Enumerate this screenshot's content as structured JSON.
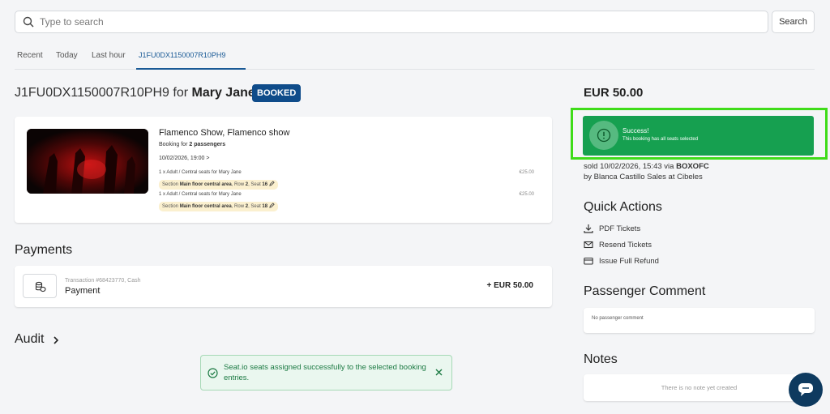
{
  "search": {
    "placeholder": "Type to search",
    "value": "",
    "button_label": "Search"
  },
  "tabs": [
    {
      "label": "Recent"
    },
    {
      "label": "Today"
    },
    {
      "label": "Last hour"
    },
    {
      "label": "J1FU0DX1150007R10PH9",
      "active": true
    }
  ],
  "booking": {
    "code": "J1FU0DX1150007R10PH9",
    "for_word": " for ",
    "customer": "Mary Jane",
    "status": "BOOKED"
  },
  "show": {
    "name": "Flamenco Show, Flamenco show",
    "booking_for_prefix": "Booking for ",
    "booking_for_count": "2 passengers",
    "date": "10/02/2026, 19:00 >",
    "lines": [
      {
        "desc": "1 x Adult / Central seats for ",
        "name": "Mary Jane",
        "price": "€25.00",
        "section_prefix": "Section ",
        "section": "Main floor central area",
        "row_prefix": ", Row ",
        "row": "2",
        "seat_prefix": ", Seat ",
        "seat": "16"
      },
      {
        "desc": "1 x Adult / Central seats for ",
        "name": "Mary Jane",
        "price": "€25.00",
        "section_prefix": "Section ",
        "section": "Main floor central area",
        "row_prefix": ", Row ",
        "row": "2",
        "seat_prefix": ", Seat ",
        "seat": "18"
      }
    ]
  },
  "payments": {
    "heading": "Payments",
    "transaction": "Transaction #68423770, Cash",
    "label": "Payment",
    "amount": "+ EUR 50.00"
  },
  "audit": {
    "heading": "Audit"
  },
  "toast": {
    "message": "Seat.io seats assigned successfully to the selected booking entries."
  },
  "summary": {
    "total": "EUR 50.00",
    "success_title": "Success!",
    "success_sub": "This booking has all seats selected",
    "sold_prefix": "sold 10/02/2026, 15:43 via ",
    "sold_channel": "BOXOFC",
    "sold_by": "by Blanca Castillo Sales at Cibeles"
  },
  "quick_actions": {
    "heading": "Quick Actions",
    "items": [
      {
        "label": "PDF Tickets",
        "icon": "download-icon"
      },
      {
        "label": "Resend Tickets",
        "icon": "mail-icon"
      },
      {
        "label": "Issue Full Refund",
        "icon": "credit-card-icon"
      }
    ]
  },
  "passenger_comment": {
    "heading": "Passenger Comment",
    "text": "No passenger comment"
  },
  "notes": {
    "heading": "Notes",
    "text": "There is no note yet created"
  },
  "colors": {
    "primary": "#0f4c8a",
    "success": "#16a050",
    "highlight": "#3fdc19",
    "chat": "#0e3a5f"
  }
}
